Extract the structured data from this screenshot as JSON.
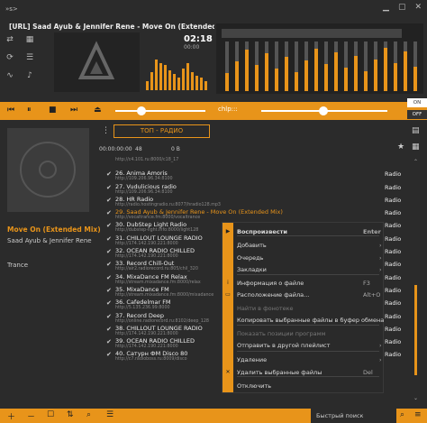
{
  "titlebar": {
    "track": "[URL] Saad Ayub & Jennifer Rene - Move On (Extended Mix) <",
    "nav_left": "»s>"
  },
  "time": {
    "elapsed": "02:18",
    "sub": "00:00"
  },
  "now_playing": {
    "title": "Move On (Extended Mix)",
    "artist": "Saad Ayub & Jennifer Rene",
    "genre": "Trance"
  },
  "control": {
    "chip": "chlp:::",
    "on": "ON",
    "off": "OFF"
  },
  "playlist": {
    "tab": "ТОП - РАДИО",
    "stats": {
      "time": "00:00:00:00",
      "count": "48",
      "size": "0 B"
    },
    "rows": [
      {
        "n": "",
        "name": "",
        "url": "http://c4.101.ru:8000/c18_17",
        "type": ""
      },
      {
        "n": "",
        "name": "26. Anima Amoris",
        "url": "http://109.206.96.34:8100",
        "type": "Radio"
      },
      {
        "n": "",
        "name": "27. Vudulicious radio",
        "url": "http://109.206.96.34:8100",
        "type": "Radio"
      },
      {
        "n": "",
        "name": "28. HR Radio",
        "url": "http://radio.hostingradio.ru:8077/hradio128.mp3",
        "type": "Radio"
      },
      {
        "n": "sel",
        "name": "29. Saad Ayub & Jennifer Rene - Move On (Extended Mix)",
        "url": "http://vocaltrance.fm:8000/vocaltrance",
        "type": "Radio"
      },
      {
        "n": "",
        "name": "30. DubStep Light Radio",
        "url": "http://dubstep-light.info:8000/light128",
        "type": "Radio"
      },
      {
        "n": "",
        "name": "31. CHILLOUT LOUNGE RADIO",
        "url": "http://174.142.190.221:8000",
        "type": "Radio"
      },
      {
        "n": "",
        "name": "32. OCEAN RADIO CHILLED",
        "url": "http://174.142.190.221:8000",
        "type": "Radio"
      },
      {
        "n": "",
        "name": "33. Record Chill-Out",
        "url": "http://air2.radiorecord.ru:805/chil_320",
        "type": "Radio"
      },
      {
        "n": "",
        "name": "34. MixaDance FM Relax",
        "url": "http://stream.mixadance.fm:8000/relax",
        "type": "Radio"
      },
      {
        "n": "",
        "name": "35. MixaDance FM",
        "url": "http://stream.mixadance.fm:8000/mixadance",
        "type": "Radio"
      },
      {
        "n": "",
        "name": "36. Cafedelmar FM",
        "url": "http://5.135.236.99:8000",
        "type": "Radio"
      },
      {
        "n": "",
        "name": "37. Record Deep",
        "url": "http://online.radiorecord.ru:8102/deep_128",
        "type": "Radio"
      },
      {
        "n": "",
        "name": "38. CHILLOUT LOUNGE RADIO",
        "url": "http://174.142.190.221:8000",
        "type": "Radio"
      },
      {
        "n": "",
        "name": "39. OCEAN RADIO CHILLED",
        "url": "http://174.142.190.221:8000",
        "type": "Radio"
      },
      {
        "n": "",
        "name": "40. Сатурн ФМ Disco 80",
        "url": "http://c7.radioboss.ru:8009/disco",
        "type": "Radio"
      },
      {
        "n": "",
        "name": "",
        "url": "",
        "type": ""
      }
    ]
  },
  "menu": {
    "items": [
      {
        "label": "Воспроизвести",
        "shortcut": "Enter",
        "bold": true,
        "arrow": false,
        "dis": false,
        "icon": "play-icon"
      },
      {
        "label": "Добавить",
        "shortcut": "",
        "arrow": true,
        "dis": false,
        "icon": ""
      },
      {
        "label": "Очередь",
        "shortcut": "",
        "arrow": true,
        "dis": false,
        "icon": ""
      },
      {
        "label": "Закладки",
        "shortcut": "",
        "arrow": true,
        "dis": false,
        "icon": ""
      },
      {
        "label": "Информация о файле",
        "shortcut": "F3",
        "arrow": false,
        "dis": false,
        "icon": "info-icon"
      },
      {
        "label": "Расположение файла...",
        "shortcut": "Alt+O",
        "arrow": false,
        "dis": false,
        "icon": "folder-icon"
      },
      {
        "label": "Найти в фонотеке",
        "shortcut": "",
        "arrow": false,
        "dis": true,
        "icon": ""
      },
      {
        "label": "Копировать выбранные файлы в буфер обмена",
        "shortcut": "",
        "arrow": false,
        "dis": false,
        "icon": ""
      },
      {
        "label": "Показать позиции программ",
        "shortcut": "",
        "arrow": false,
        "dis": true,
        "icon": ""
      },
      {
        "label": "Отправить в другой плейлист",
        "shortcut": "",
        "arrow": true,
        "dis": false,
        "icon": ""
      },
      {
        "label": "Удаление",
        "shortcut": "",
        "arrow": true,
        "dis": false,
        "icon": ""
      },
      {
        "label": "Удалить выбранные файлы",
        "shortcut": "Del",
        "arrow": false,
        "dis": false,
        "icon": "trash-icon"
      },
      {
        "label": "Отключить",
        "shortcut": "",
        "arrow": false,
        "dis": false,
        "icon": ""
      }
    ]
  },
  "search": {
    "label": "Быстрый поиск"
  },
  "colors": {
    "accent": "#e8941a",
    "bg": "#2b2b2b"
  }
}
